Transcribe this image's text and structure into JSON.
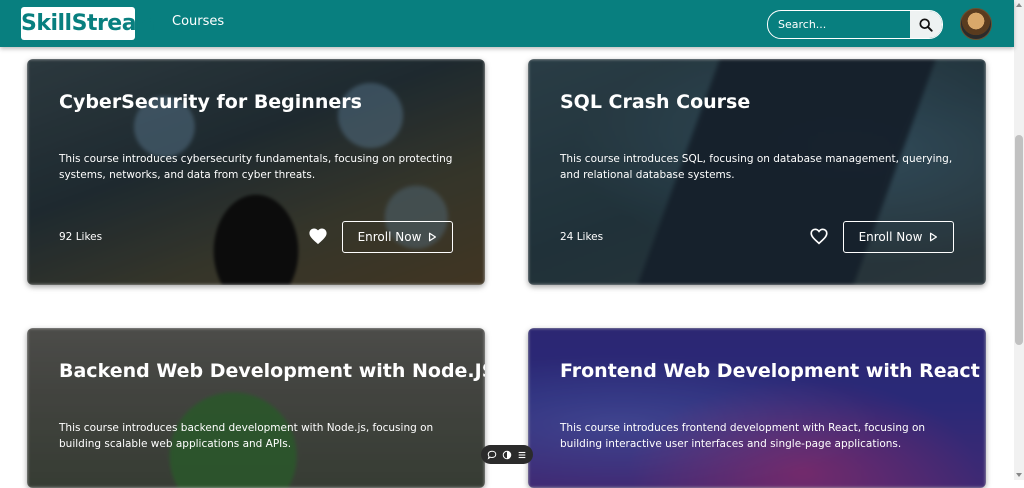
{
  "header": {
    "logo": "SkillStream",
    "nav": {
      "courses": "Courses"
    },
    "search": {
      "placeholder": "Search..."
    }
  },
  "courses": [
    {
      "title": "CyberSecurity for Beginners",
      "description": "This course introduces cybersecurity fundamentals, focusing on protecting systems, networks, and data from cyber threats.",
      "likes": "92 Likes",
      "liked": true,
      "enroll_label": "Enroll Now"
    },
    {
      "title": "SQL Crash Course",
      "description": "This course introduces SQL, focusing on database management, querying, and relational database systems.",
      "likes": "24 Likes",
      "liked": false,
      "enroll_label": "Enroll Now"
    },
    {
      "title": "Backend Web Development with Node.JS",
      "description": "This course introduces backend development with Node.js, focusing on building scalable web applications and APIs."
    },
    {
      "title": "Frontend Web Development with React",
      "description": "This course introduces frontend development with React, focusing on building interactive user interfaces and single-page applications."
    }
  ],
  "colors": {
    "brand": "#087f7f",
    "header_text": "#ffffff"
  },
  "icons": {
    "search": "search-icon",
    "heart_filled": "heart-filled-icon",
    "heart_outline": "heart-outline-icon",
    "play": "play-icon",
    "chat": "chat-icon",
    "toggle": "toggle-icon",
    "menu": "menu-icon"
  }
}
